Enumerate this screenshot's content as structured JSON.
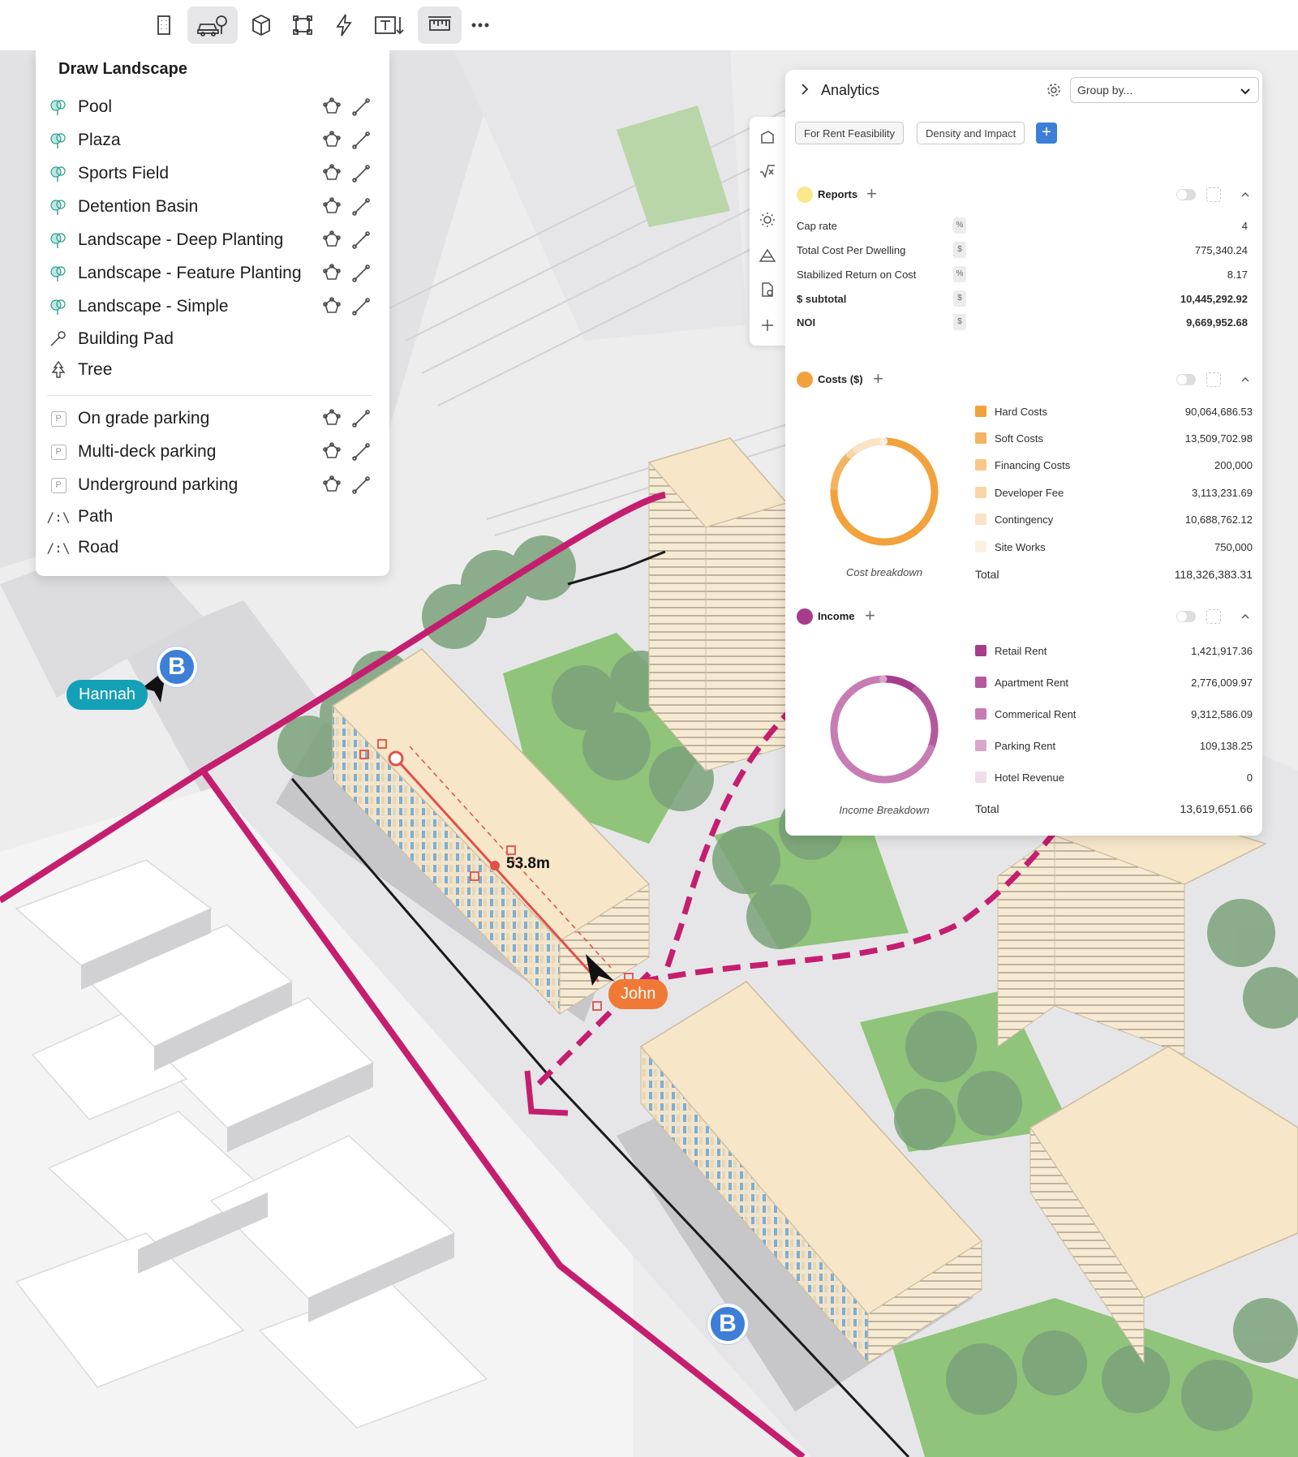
{
  "toolbar": {
    "tools": [
      {
        "name": "building-tool",
        "icon": "building-icon",
        "active": false
      },
      {
        "name": "landscape-tool",
        "icon": "car-tree-icon",
        "active": true
      },
      {
        "name": "massing-tool",
        "icon": "cube-icon",
        "active": false
      },
      {
        "name": "frame-tool",
        "icon": "frame-icon",
        "active": false
      },
      {
        "name": "energy-tool",
        "icon": "lightning-icon",
        "active": false
      },
      {
        "name": "text-tool",
        "icon": "text-icon",
        "active": false
      },
      {
        "name": "measure-tool",
        "icon": "ruler-icon",
        "active": true
      },
      {
        "name": "more-tool",
        "icon": "more-icon",
        "active": false
      }
    ]
  },
  "landscape_panel": {
    "title": "Draw Landscape",
    "items": [
      {
        "label": "Pool",
        "icon": "tree-icon"
      },
      {
        "label": "Plaza",
        "icon": "tree-icon"
      },
      {
        "label": "Sports Field",
        "icon": "tree-icon"
      },
      {
        "label": "Detention Basin",
        "icon": "tree-icon"
      },
      {
        "label": "Landscape - Deep Planting",
        "icon": "tree-icon"
      },
      {
        "label": "Landscape - Feature Planting",
        "icon": "tree-icon"
      },
      {
        "label": "Landscape - Simple",
        "icon": "tree-icon"
      },
      {
        "label": "Building Pad",
        "icon": "pad-icon"
      },
      {
        "label": "Tree",
        "icon": "pine-tree-icon"
      }
    ],
    "parking_items": [
      {
        "label": "On grade parking",
        "icon_text": "P"
      },
      {
        "label": "Multi-deck parking",
        "icon_text": "P"
      },
      {
        "label": "Underground parking",
        "icon_text": "P"
      },
      {
        "label": "Path",
        "icon_text": "/:\\"
      },
      {
        "label": "Road",
        "icon_text": "/:\\"
      }
    ]
  },
  "map": {
    "users": {
      "hannah": "Hannah",
      "john": "John"
    },
    "marker_letter": "B",
    "measurement": "53.8m"
  },
  "analytics": {
    "title": "Analytics",
    "group_by_placeholder": "Group by...",
    "tabs": [
      "For Rent Feasibility",
      "Density and Impact"
    ],
    "add_tab": "+",
    "reports": {
      "label": "Reports",
      "color": "#fbe78c",
      "rows": [
        {
          "label": "Cap rate",
          "unit": "%",
          "value": "4",
          "bold": false
        },
        {
          "label": "Total Cost Per Dwelling",
          "unit": "$",
          "value": "775,340.24",
          "bold": false
        },
        {
          "label": "Stabilized Return on Cost",
          "unit": "%",
          "value": "8.17",
          "bold": false
        },
        {
          "label": "$ subtotal",
          "unit": "$",
          "value": "10,445,292.92",
          "bold": true
        },
        {
          "label": "NOI",
          "unit": "$",
          "value": "9,669,952.68",
          "bold": true
        }
      ]
    },
    "costs": {
      "label": "Costs ($)",
      "color": "#f2a13b",
      "caption": "Cost breakdown",
      "items": [
        {
          "label": "Hard Costs",
          "value": "90,064,686.53",
          "amount": 90064686.53,
          "color": "#f2a13b"
        },
        {
          "label": "Soft Costs",
          "value": "13,509,702.98",
          "amount": 13509702.98,
          "color": "#f4b35e"
        },
        {
          "label": "Financing Costs",
          "value": "200,000",
          "amount": 200000,
          "color": "#f7c789"
        },
        {
          "label": "Developer Fee",
          "value": "3,113,231.69",
          "amount": 3113231.69,
          "color": "#f9d6a6"
        },
        {
          "label": "Contingency",
          "value": "10,688,762.12",
          "amount": 10688762.12,
          "color": "#fbe3c4"
        },
        {
          "label": "Site Works",
          "value": "750,000",
          "amount": 750000,
          "color": "#fdf0e0"
        }
      ],
      "total_label": "Total",
      "total_value": "118,326,383.31"
    },
    "income": {
      "label": "Income",
      "color": "#a73c8c",
      "caption": "Income Breakdown",
      "items": [
        {
          "label": "Retail Rent",
          "value": "1,421,917.36",
          "amount": 1421917.36,
          "color": "#a73c8c"
        },
        {
          "label": "Apartment Rent",
          "value": "2,776,009.97",
          "amount": 2776009.97,
          "color": "#b45a9c"
        },
        {
          "label": "Commerical Rent",
          "value": "9,312,586.09",
          "amount": 9312586.09,
          "color": "#c77cb3"
        },
        {
          "label": "Parking Rent",
          "value": "109,138.25",
          "amount": 109138.25,
          "color": "#dba6cc"
        },
        {
          "label": "Hotel Revenue",
          "value": "0",
          "amount": 0,
          "color": "#f1dceb"
        }
      ],
      "total_label": "Total",
      "total_value": "13,619,651.66"
    }
  }
}
